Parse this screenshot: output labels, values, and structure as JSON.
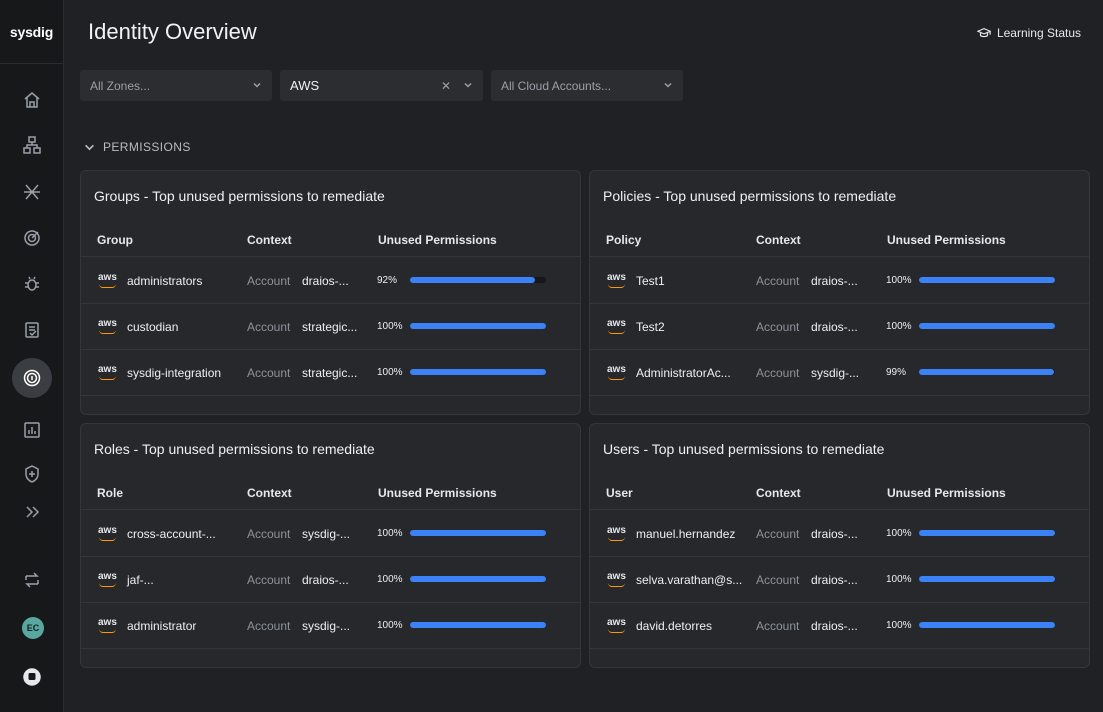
{
  "brand": "sysdig",
  "header": {
    "title": "Identity Overview",
    "learning_status": "Learning Status"
  },
  "filters": {
    "zones": "All Zones...",
    "provider": "AWS",
    "accounts": "All Cloud Accounts..."
  },
  "section": {
    "label": "PERMISSIONS"
  },
  "sidebar": {
    "items": [
      {
        "icon": "home-icon"
      },
      {
        "icon": "inventory-icon"
      },
      {
        "icon": "integrations-icon"
      },
      {
        "icon": "threats-icon"
      },
      {
        "icon": "vulnerabilities-icon"
      },
      {
        "icon": "posture-icon"
      },
      {
        "icon": "identity-icon",
        "active": true
      },
      {
        "icon": "reports-icon"
      },
      {
        "icon": "policies-icon"
      },
      {
        "icon": "expand-icon"
      },
      {
        "icon": "switch-icon"
      },
      {
        "icon": "help-icon"
      }
    ],
    "avatar_initials": "EC"
  },
  "cards": {
    "groups": {
      "title": "Groups - Top unused permissions to remediate",
      "col1": "Group",
      "col2": "Context",
      "col3": "Unused Permissions",
      "rows": [
        {
          "name": "administrators",
          "ctx_label": "Account",
          "ctx_value": "draios-...",
          "pct_label": "92%",
          "pct": 92
        },
        {
          "name": "custodian",
          "ctx_label": "Account",
          "ctx_value": "strategic...",
          "pct_label": "100%",
          "pct": 100
        },
        {
          "name": "sysdig-integration",
          "ctx_label": "Account",
          "ctx_value": "strategic...",
          "pct_label": "100%",
          "pct": 100
        }
      ]
    },
    "policies": {
      "title": "Policies - Top unused permissions to remediate",
      "col1": "Policy",
      "col2": "Context",
      "col3": "Unused Permissions",
      "rows": [
        {
          "name": "Test1",
          "ctx_label": "Account",
          "ctx_value": "draios-...",
          "pct_label": "100%",
          "pct": 100
        },
        {
          "name": "Test2",
          "ctx_label": "Account",
          "ctx_value": "draios-...",
          "pct_label": "100%",
          "pct": 100
        },
        {
          "name": "AdministratorAc...",
          "ctx_label": "Account",
          "ctx_value": "sysdig-...",
          "pct_label": "99%",
          "pct": 99
        }
      ]
    },
    "roles": {
      "title": "Roles - Top unused permissions to remediate",
      "col1": "Role",
      "col2": "Context",
      "col3": "Unused Permissions",
      "rows": [
        {
          "name": "cross-account-...",
          "ctx_label": "Account",
          "ctx_value": "sysdig-...",
          "pct_label": "100%",
          "pct": 100
        },
        {
          "name": "jaf-...",
          "ctx_label": "Account",
          "ctx_value": "draios-...",
          "pct_label": "100%",
          "pct": 100
        },
        {
          "name": "administrator",
          "ctx_label": "Account",
          "ctx_value": "sysdig-...",
          "pct_label": "100%",
          "pct": 100
        }
      ]
    },
    "users": {
      "title": "Users - Top unused permissions to remediate",
      "col1": "User",
      "col2": "Context",
      "col3": "Unused Permissions",
      "rows": [
        {
          "name": "manuel.hernandez",
          "ctx_label": "Account",
          "ctx_value": "draios-...",
          "pct_label": "100%",
          "pct": 100
        },
        {
          "name": "selva.varathan@s...",
          "ctx_label": "Account",
          "ctx_value": "draios-...",
          "pct_label": "100%",
          "pct": 100
        },
        {
          "name": "david.detorres",
          "ctx_label": "Account",
          "ctx_value": "draios-...",
          "pct_label": "100%",
          "pct": 100
        }
      ]
    }
  },
  "provider_badge": "aws",
  "colors": {
    "accent": "#3b82f6",
    "aws_smile": "#ff9900"
  }
}
